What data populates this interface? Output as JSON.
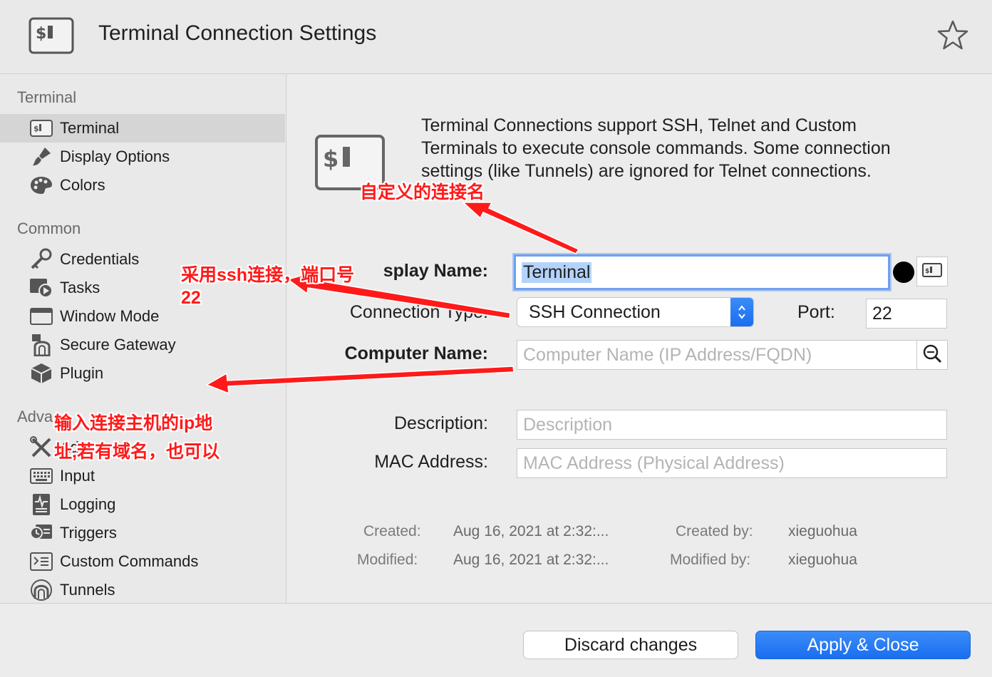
{
  "header": {
    "title": "Terminal Connection Settings"
  },
  "sidebar": {
    "sections": [
      {
        "label": "Terminal",
        "items": [
          {
            "label": "Terminal",
            "icon": "terminal-icon",
            "selected": true
          },
          {
            "label": "Display Options",
            "icon": "brush-icon"
          },
          {
            "label": "Colors",
            "icon": "palette-icon"
          }
        ]
      },
      {
        "label": "Common",
        "items": [
          {
            "label": "Credentials",
            "icon": "key-icon"
          },
          {
            "label": "Tasks",
            "icon": "tasks-icon"
          },
          {
            "label": "Window Mode",
            "icon": "window-icon"
          },
          {
            "label": "Secure Gateway",
            "icon": "gateway-icon"
          },
          {
            "label": "Plugin",
            "icon": "plugin-icon"
          }
        ]
      },
      {
        "label": "Adva",
        "items": [
          {
            "label": "Adva",
            "icon": "tools-icon"
          },
          {
            "label": "Input",
            "icon": "keyboard-icon"
          },
          {
            "label": "Logging",
            "icon": "log-icon"
          },
          {
            "label": "Triggers",
            "icon": "trigger-icon"
          },
          {
            "label": "Custom Commands",
            "icon": "commands-icon"
          },
          {
            "label": "Tunnels",
            "icon": "tunnel-icon"
          }
        ]
      }
    ]
  },
  "main": {
    "intro_lines": [
      "Terminal Connections support SSH, Telnet and Custom",
      "Terminals to execute console commands. Some connection",
      "settings (like Tunnels) are ignored for Telnet connections."
    ],
    "display_name": {
      "label": "splay Name:",
      "value": "Terminal"
    },
    "connection_type": {
      "label": "Connection Type:",
      "value": "SSH Connection"
    },
    "port": {
      "label": "Port:",
      "value": "22"
    },
    "computer_name": {
      "label": "Computer Name:",
      "placeholder": "Computer Name (IP Address/FQDN)"
    },
    "description": {
      "label": "Description:",
      "placeholder": "Description"
    },
    "mac_address": {
      "label": "MAC Address:",
      "placeholder": "MAC Address (Physical Address)"
    },
    "meta": {
      "created_label": "Created:",
      "created_value": "Aug 16, 2021 at 2:32:...",
      "modified_label": "Modified:",
      "modified_value": "Aug 16, 2021 at 2:32:...",
      "created_by_label": "Created by:",
      "created_by_value": "xieguohua",
      "modified_by_label": "Modified by:",
      "modified_by_value": "xieguohua"
    }
  },
  "footer": {
    "discard_label": "Discard changes",
    "apply_label": "Apply & Close"
  },
  "annotations": {
    "a1": "自定义的连接名",
    "a2_line1": "采用ssh连接，端口号",
    "a2_line2": "22",
    "a3_line1": "输入连接主机的ip地",
    "a3_line2": "址,若有域名，也可以"
  },
  "colors": {
    "accent": "#1a6ef0",
    "annotation": "#ff1a1a",
    "selection": "#b3d3fb"
  }
}
